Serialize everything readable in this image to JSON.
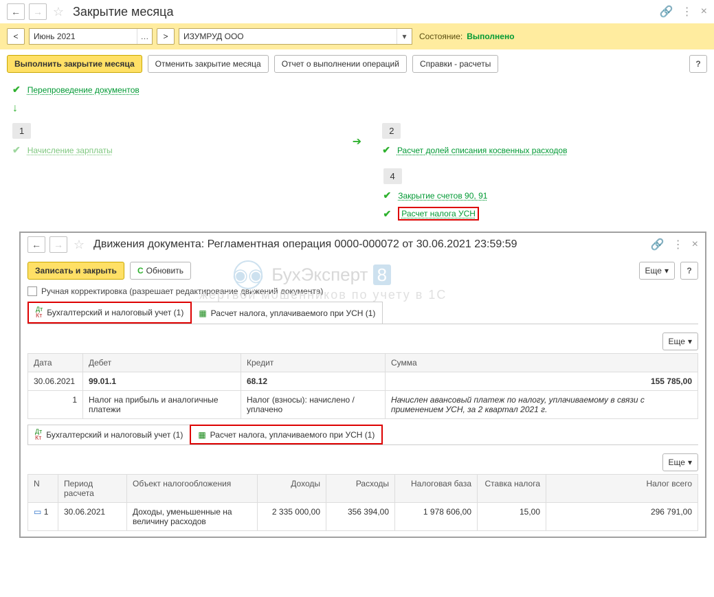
{
  "titlebar": {
    "title": "Закрытие месяца"
  },
  "filter": {
    "period": "Июнь 2021",
    "org": "ИЗУМРУД ООО",
    "status_label": "Состояние:",
    "status_value": "Выполнено"
  },
  "toolbar": {
    "execute": "Выполнить закрытие месяца",
    "cancel": "Отменить закрытие месяца",
    "report": "Отчет о выполнении операций",
    "refs": "Справки - расчеты"
  },
  "ops": {
    "repost": "Перепроведение документов",
    "step1": "1",
    "step1_link": "Начисление зарплаты",
    "step2": "2",
    "step2_link": "Расчет долей списания косвенных расходов",
    "step4": "4",
    "step4_link1": "Закрытие счетов 90, 91",
    "step4_link2": "Расчет налога УСН"
  },
  "inner": {
    "title": "Движения документа: Регламентная операция 0000-000072 от 30.06.2021 23:59:59",
    "save": "Записать и закрыть",
    "refresh": "Обновить",
    "more": "Еще",
    "manual": "Ручная корректировка (разрешает редактирование движений документа)",
    "tab1": "Бухгалтерский и налоговый учет (1)",
    "tab2": "Расчет налога, уплачиваемого при УСН (1)",
    "watermark1": "БухЭксперт",
    "watermark1_badge": "8",
    "watermark2": "жертвой мошенников по учету в 1С",
    "t1": {
      "h_date": "Дата",
      "h_debit": "Дебет",
      "h_credit": "Кредит",
      "h_sum": "Сумма",
      "date": "30.06.2021",
      "row_n": "1",
      "debit_acc": "99.01.1",
      "debit_desc": "Налог на прибыль и аналогичные платежи",
      "credit_acc": "68.12",
      "credit_desc": "Налог (взносы): начислено / уплачено",
      "sum": "155 785,00",
      "comment": "Начислен авансовый платеж по налогу, уплачиваемому в связи с применением УСН, за 2 квартал 2021 г."
    },
    "t2": {
      "h_n": "N",
      "h_period": "Период расчета",
      "h_obj": "Объект налогообложения",
      "h_income": "Доходы",
      "h_expense": "Расходы",
      "h_base": "Налоговая база",
      "h_rate": "Ставка налога",
      "h_total": "Налог всего",
      "n": "1",
      "period": "30.06.2021",
      "obj": "Доходы, уменьшенные на величину расходов",
      "income": "2 335 000,00",
      "expense": "356 394,00",
      "base": "1 978 606,00",
      "rate": "15,00",
      "total": "296 791,00"
    }
  }
}
